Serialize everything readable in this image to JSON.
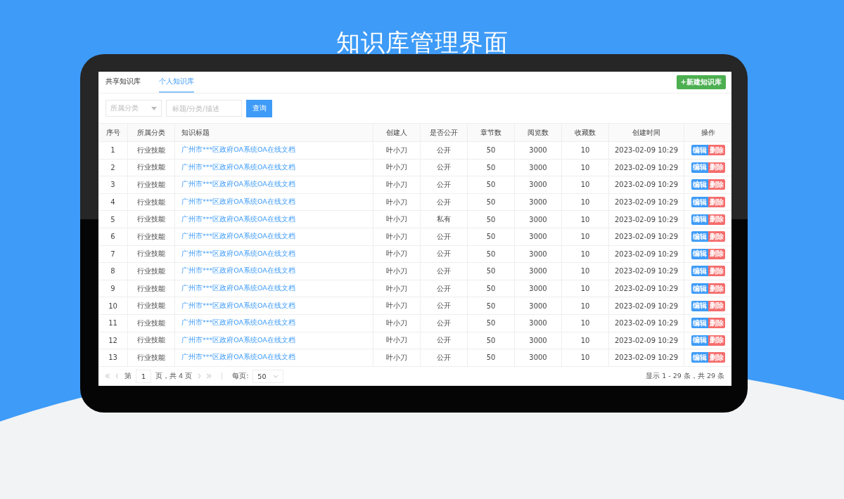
{
  "title": "知识库管理界面",
  "tabs": [
    {
      "label": "共享知识库",
      "selected": false
    },
    {
      "label": "个人知识库",
      "selected": true
    }
  ],
  "new_button": "+新建知识库",
  "filters": {
    "category": {
      "placeholder": "所属分类"
    },
    "search": {
      "placeholder": "标题/分类/描述"
    },
    "query_button": "查询"
  },
  "table": {
    "columns": [
      "序号",
      "所属分类",
      "知识标题",
      "创建人",
      "是否公开",
      "章节数",
      "阅览数",
      "收藏数",
      "创建时间",
      "操作"
    ],
    "rows": [
      {
        "index": "1",
        "category": "行业技能",
        "title": "广州市***区政府OA系统OA在线文档",
        "creator": "叶小刀",
        "public": "公开",
        "chapters": "50",
        "views": "3000",
        "favorites": "10",
        "created": "2023-02-09 10:29",
        "actions": [
          "编辑",
          "删除"
        ]
      },
      {
        "index": "2",
        "category": "行业技能",
        "title": "广州市***区政府OA系统OA在线文档",
        "creator": "叶小刀",
        "public": "公开",
        "chapters": "50",
        "views": "3000",
        "favorites": "10",
        "created": "2023-02-09 10:29",
        "actions": [
          "编辑",
          "删除"
        ]
      },
      {
        "index": "3",
        "category": "行业技能",
        "title": "广州市***区政府OA系统OA在线文档",
        "creator": "叶小刀",
        "public": "公开",
        "chapters": "50",
        "views": "3000",
        "favorites": "10",
        "created": "2023-02-09 10:29",
        "actions": [
          "编辑",
          "删除"
        ]
      },
      {
        "index": "4",
        "category": "行业技能",
        "title": "广州市***区政府OA系统OA在线文档",
        "creator": "叶小刀",
        "public": "公开",
        "chapters": "50",
        "views": "3000",
        "favorites": "10",
        "created": "2023-02-09 10:29",
        "actions": [
          "编辑",
          "删除"
        ]
      },
      {
        "index": "5",
        "category": "行业技能",
        "title": "广州市***区政府OA系统OA在线文档",
        "creator": "叶小刀",
        "public": "私有",
        "chapters": "50",
        "views": "3000",
        "favorites": "10",
        "created": "2023-02-09 10:29",
        "actions": [
          "编辑",
          "删除"
        ]
      },
      {
        "index": "6",
        "category": "行业技能",
        "title": "广州市***区政府OA系统OA在线文档",
        "creator": "叶小刀",
        "public": "公开",
        "chapters": "50",
        "views": "3000",
        "favorites": "10",
        "created": "2023-02-09 10:29",
        "actions": [
          "编辑",
          "删除"
        ]
      },
      {
        "index": "7",
        "category": "行业技能",
        "title": "广州市***区政府OA系统OA在线文档",
        "creator": "叶小刀",
        "public": "公开",
        "chapters": "50",
        "views": "3000",
        "favorites": "10",
        "created": "2023-02-09 10:29",
        "actions": [
          "编辑",
          "删除"
        ]
      },
      {
        "index": "8",
        "category": "行业技能",
        "title": "广州市***区政府OA系统OA在线文档",
        "creator": "叶小刀",
        "public": "公开",
        "chapters": "50",
        "views": "3000",
        "favorites": "10",
        "created": "2023-02-09 10:29",
        "actions": [
          "编辑",
          "删除"
        ]
      },
      {
        "index": "9",
        "category": "行业技能",
        "title": "广州市***区政府OA系统OA在线文档",
        "creator": "叶小刀",
        "public": "公开",
        "chapters": "50",
        "views": "3000",
        "favorites": "10",
        "created": "2023-02-09 10:29",
        "actions": [
          "编辑",
          "删除"
        ]
      },
      {
        "index": "10",
        "category": "行业技能",
        "title": "广州市***区政府OA系统OA在线文档",
        "creator": "叶小刀",
        "public": "公开",
        "chapters": "50",
        "views": "3000",
        "favorites": "10",
        "created": "2023-02-09 10:29",
        "actions": [
          "编辑",
          "删除"
        ]
      },
      {
        "index": "11",
        "category": "行业技能",
        "title": "广州市***区政府OA系统OA在线文档",
        "creator": "叶小刀",
        "public": "公开",
        "chapters": "50",
        "views": "3000",
        "favorites": "10",
        "created": "2023-02-09 10:29",
        "actions": [
          "编辑",
          "删除"
        ]
      },
      {
        "index": "12",
        "category": "行业技能",
        "title": "广州市***区政府OA系统OA在线文档",
        "creator": "叶小刀",
        "public": "公开",
        "chapters": "50",
        "views": "3000",
        "favorites": "10",
        "created": "2023-02-09 10:29",
        "actions": [
          "编辑",
          "删除"
        ]
      },
      {
        "index": "13",
        "category": "行业技能",
        "title": "广州市***区政府OA系统OA在线文档",
        "creator": "叶小刀",
        "public": "公开",
        "chapters": "50",
        "views": "3000",
        "favorites": "10",
        "created": "2023-02-09 10:29",
        "actions": [
          "编辑",
          "删除"
        ]
      }
    ]
  },
  "pagination": {
    "page_prefix": "第",
    "page": "1",
    "page_suffix": "页，共 4 页",
    "per_page_label": "每页:",
    "per_page": "50",
    "summary": "显示 1 - 29 条，共 29 条"
  }
}
